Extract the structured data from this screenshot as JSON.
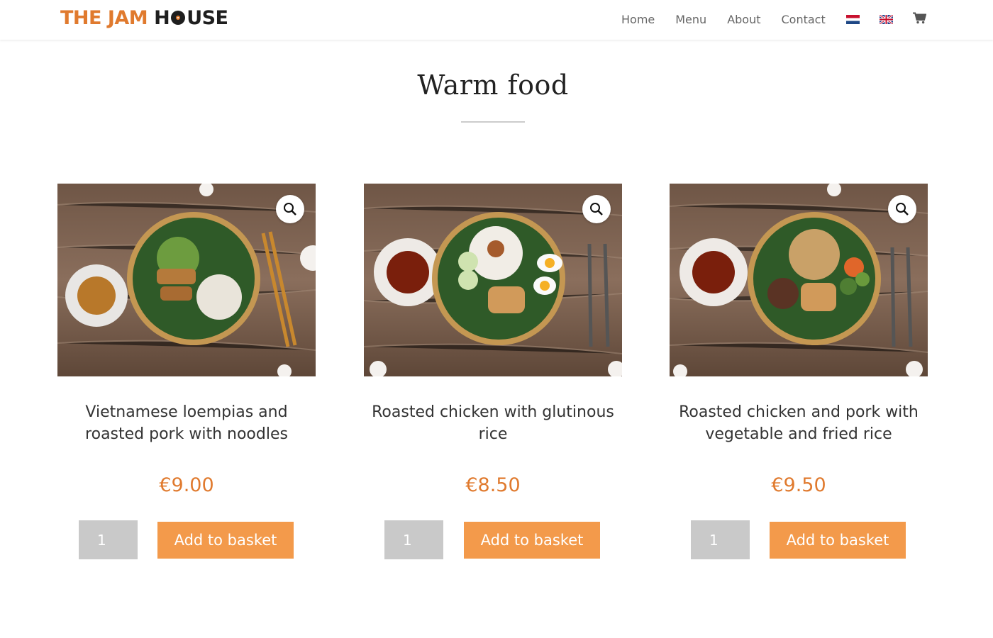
{
  "brand": {
    "part1": "THE JAM",
    "part2": "H",
    "part3": "USE",
    "accent_color": "#e07a2e",
    "dark_color": "#1e1e1e"
  },
  "nav": {
    "items": [
      {
        "label": "Home"
      },
      {
        "label": "Menu"
      },
      {
        "label": "About"
      },
      {
        "label": "Contact"
      }
    ],
    "flags": [
      "netherlands-flag-icon",
      "uk-flag-icon"
    ],
    "cart_icon": "cart-icon"
  },
  "page": {
    "title": "Warm food"
  },
  "products": [
    {
      "title": "Vietnamese loempias and roasted pork with noodles",
      "price": "€9.00",
      "quantity": "1",
      "button_label": "Add to basket",
      "zoom_icon": "search-icon"
    },
    {
      "title": "Roasted chicken with glutinous rice",
      "price": "€8.50",
      "quantity": "1",
      "button_label": "Add to basket",
      "zoom_icon": "search-icon"
    },
    {
      "title": "Roasted chicken and pork with vegetable and fried rice",
      "price": "€9.50",
      "quantity": "1",
      "button_label": "Add to basket",
      "zoom_icon": "search-icon"
    }
  ],
  "colors": {
    "price": "#e07a2e",
    "button": "#f39a4b",
    "quantity_box": "#c9c9c9",
    "nav_text": "#666666"
  }
}
